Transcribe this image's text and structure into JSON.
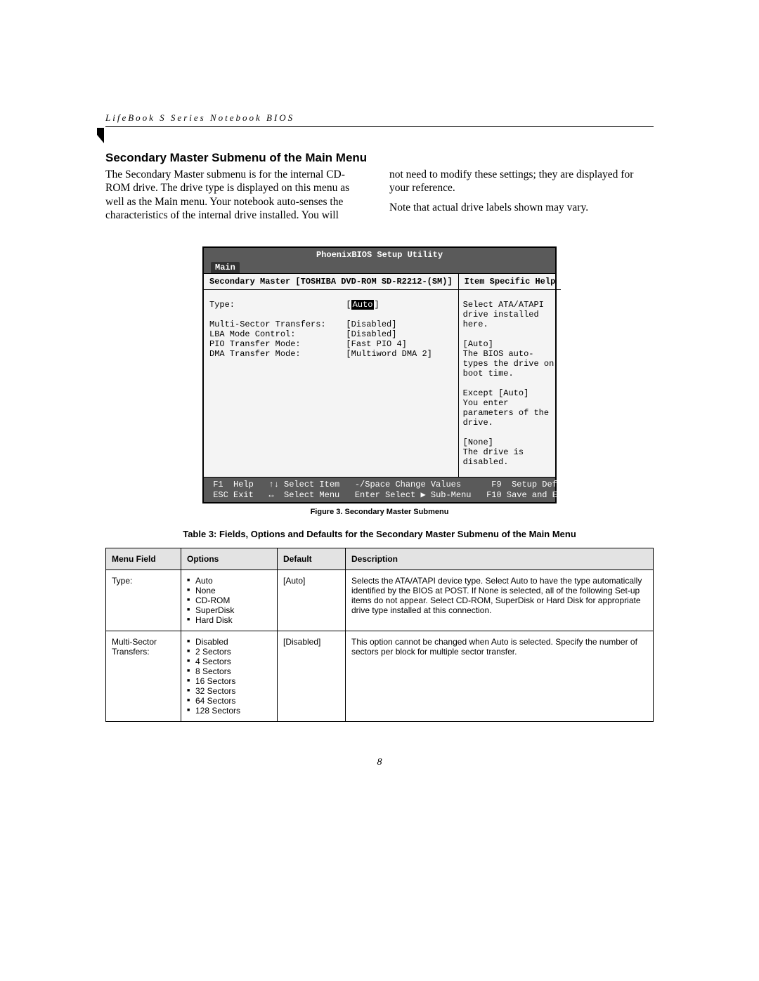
{
  "header_line": "LifeBook S Series Notebook BIOS",
  "section_title": "Secondary Master Submenu of the Main Menu",
  "intro_left": "The Secondary Master submenu is for the internal CD-ROM drive. The drive type is displayed on this menu as well as the Main menu. Your notebook auto-senses the characteristics of the internal drive installed. You will",
  "intro_right_1": "not need to modify these settings;  they are displayed for your reference.",
  "intro_right_2": "Note that actual drive labels shown may vary.",
  "bios": {
    "title": "PhoenixBIOS Setup Utility",
    "tab": "Main",
    "breadcrumb": "Secondary Master [TOSHIBA DVD-ROM SD-R2212-(SM)]",
    "help_header": "Item Specific Help",
    "type_label": "Type:",
    "type_value": "Auto",
    "rows": [
      {
        "label": "Multi-Sector Transfers:",
        "value": "[Disabled]"
      },
      {
        "label": "LBA Mode Control:",
        "value": "[Disabled]"
      },
      {
        "label": "PIO Transfer Mode:",
        "value": "[Fast PIO 4]"
      },
      {
        "label": "DMA Transfer Mode:",
        "value": "[Multiword DMA 2]"
      }
    ],
    "help_text": "Select ATA/ATAPI drive installed here.\n\n[Auto]\nThe BIOS auto-types the drive on boot time.\n\nExcept [Auto]\nYou enter parameters of the drive.\n\n[None]\nThe drive is disabled.",
    "footer": {
      "f1": "F1",
      "help": "Help",
      "selitem": "Select Item",
      "changespace": "-/Space",
      "changevals": "Change Values",
      "f9": "F9",
      "setupdef": "Setup Defaults",
      "esc": "ESC",
      "exit": "Exit",
      "selmenu": "Select Menu",
      "enter": "Enter",
      "submenu": "Select ▶ Sub-Menu",
      "f10": "F10",
      "save": "Save and Exit"
    }
  },
  "figure_caption": "Figure 3.  Secondary Master Submenu",
  "table_caption": "Table 3: Fields, Options and Defaults for the Secondary Master Submenu of the Main Menu",
  "table": {
    "headers": [
      "Menu Field",
      "Options",
      "Default",
      "Description"
    ],
    "rows": [
      {
        "field": "Type:",
        "options": [
          "Auto",
          "None",
          "CD-ROM",
          "SuperDisk",
          "Hard Disk"
        ],
        "default": "[Auto]",
        "description": "Selects the ATA/ATAPI device type. Select Auto to have the type automatically identified by the BIOS at POST. If None is selected, all of the following Set-up items do not appear. Select CD-ROM, SuperDisk or Hard Disk for appropriate drive type installed at this connection."
      },
      {
        "field": "Multi-Sector Transfers:",
        "options": [
          "Disabled",
          "2 Sectors",
          "4 Sectors",
          "8 Sectors",
          "16 Sectors",
          "32 Sectors",
          "64 Sectors",
          "128 Sectors"
        ],
        "default": "[Disabled]",
        "description": "This option cannot be changed when Auto is selected. Specify the number of sectors per block for multiple sector transfer."
      }
    ]
  },
  "page_number": "8"
}
